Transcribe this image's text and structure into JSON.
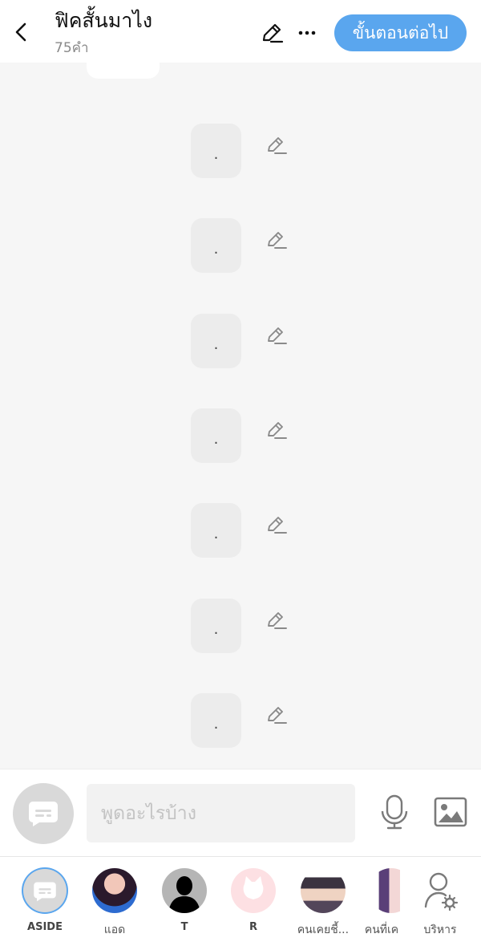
{
  "header": {
    "title": "ฟิคสั้นมาไง",
    "word_count": "75คำ",
    "next_label": "ขั้นตอนต่อไป"
  },
  "messages": [
    {
      "text": "."
    },
    {
      "text": "."
    },
    {
      "text": "."
    },
    {
      "text": "."
    },
    {
      "text": "."
    },
    {
      "text": "."
    },
    {
      "text": "."
    }
  ],
  "composer": {
    "placeholder": "พูดอะไรบ้าง"
  },
  "characters": [
    {
      "label": "ASIDE",
      "icon": "chat-bubble-icon",
      "selected": true
    },
    {
      "label": "แอด"
    },
    {
      "label": "T"
    },
    {
      "label": "R"
    },
    {
      "label": "คนเคยชี้..."
    },
    {
      "label": "คนที่เค"
    },
    {
      "label": "บริหาร",
      "icon": "user-settings-icon"
    }
  ],
  "colors": {
    "accent": "#5aa6ee",
    "background": "#f6f6f6",
    "bubble": "#ececec"
  }
}
